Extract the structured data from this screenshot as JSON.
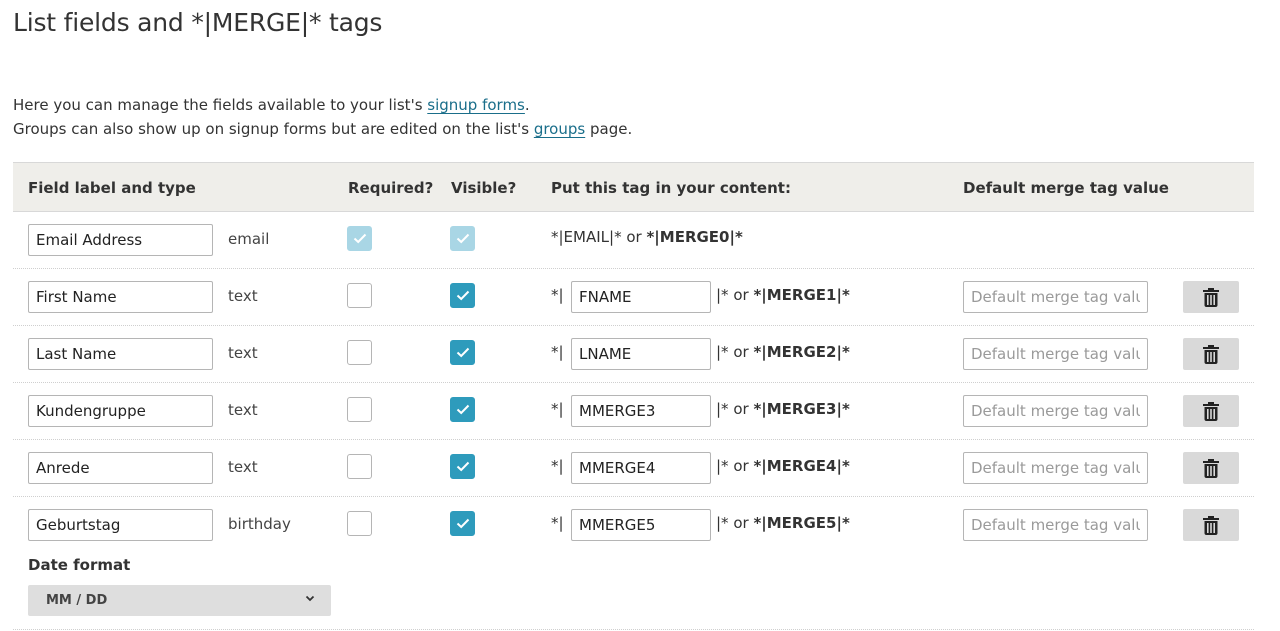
{
  "page": {
    "title": "List fields and *|MERGE|* tags",
    "intro_line1_pre": "Here you can manage the fields available to your list's ",
    "intro_line1_link": "signup forms",
    "intro_line1_post": ".",
    "intro_line2_pre": "Groups can also show up on signup forms but are edited on the list's ",
    "intro_line2_link": "groups",
    "intro_line2_post": " page."
  },
  "table": {
    "headers": {
      "field": "Field label and type",
      "required": "Required?",
      "visible": "Visible?",
      "tag": "Put this tag in your content:",
      "default": "Default merge tag value"
    },
    "email_row": {
      "label": "Email Address",
      "type": "email",
      "tag_text": "*|EMAIL|* or ",
      "tag_bold": "*|MERGE0|*"
    },
    "rows": [
      {
        "label": "First Name",
        "type": "text",
        "required": false,
        "visible": true,
        "tag": "FNAME",
        "merge": "*|MERGE1|*"
      },
      {
        "label": "Last Name",
        "type": "text",
        "required": false,
        "visible": true,
        "tag": "LNAME",
        "merge": "*|MERGE2|*"
      },
      {
        "label": "Kundengruppe",
        "type": "text",
        "required": false,
        "visible": true,
        "tag": "MMERGE3",
        "merge": "*|MERGE3|*"
      },
      {
        "label": "Anrede",
        "type": "text",
        "required": false,
        "visible": true,
        "tag": "MMERGE4",
        "merge": "*|MERGE4|*"
      },
      {
        "label": "Geburtstag",
        "type": "birthday",
        "required": false,
        "visible": true,
        "tag": "MMERGE5",
        "merge": "*|MERGE5|*"
      }
    ],
    "tag_prefix": "*|",
    "tag_suffix": "|* or ",
    "default_placeholder": "Default merge tag value",
    "date_format_label": "Date format",
    "date_format_value": "MM / DD"
  },
  "colors": {
    "checkbox_on": "#2e9bbc",
    "checkbox_disabled": "#a9d6e5",
    "link": "#1a6e8a",
    "header_bg": "#efeeea"
  },
  "icons": {
    "check": "check-icon",
    "trash": "trash-icon",
    "chevron": "chevron-down-icon"
  }
}
